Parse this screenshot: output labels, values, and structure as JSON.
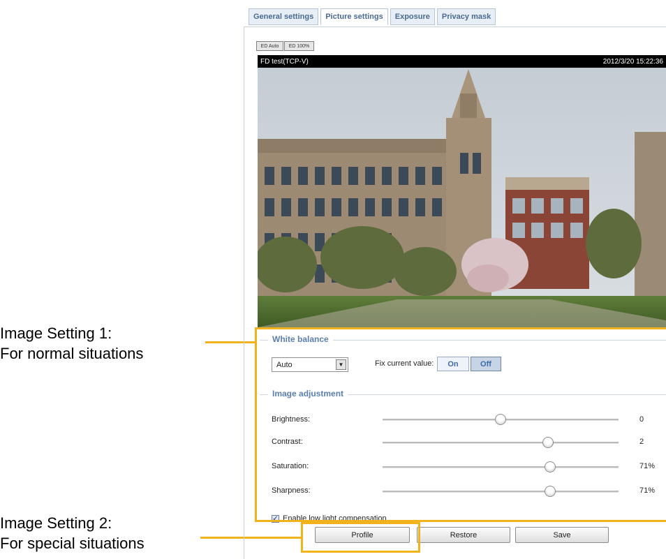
{
  "callouts": {
    "setting1": {
      "line1": "Image Setting 1:",
      "line2": "For normal situations"
    },
    "setting2": {
      "line1": "Image Setting 2:",
      "line2": "For special situations"
    },
    "color": "#f2b21c"
  },
  "tabs": [
    {
      "label": "General settings"
    },
    {
      "label": "Picture settings"
    },
    {
      "label": "Exposure"
    },
    {
      "label": "Privacy mask"
    }
  ],
  "view_buttons": [
    {
      "label": "ED Auto"
    },
    {
      "label": "ED 100%"
    }
  ],
  "video": {
    "stream_name": "FD test(TCP-V)",
    "timestamp": "2012/3/20 15:22:36"
  },
  "white_balance": {
    "legend": "White balance",
    "mode": "Auto",
    "fix_label": "Fix current value:",
    "on_label": "On",
    "off_label": "Off",
    "selected": "Off"
  },
  "image_adjustment": {
    "legend": "Image adjustment",
    "sliders": [
      {
        "label": "Brightness:",
        "value": "0",
        "level": 0.5
      },
      {
        "label": "Contrast:",
        "value": "2",
        "level": 0.7
      },
      {
        "label": "Saturation:",
        "value": "71%",
        "level": 0.71
      },
      {
        "label": "Sharpness:",
        "value": "71%",
        "level": 0.71
      }
    ],
    "low_light_label": "Enable low light compensation",
    "low_light_checked": true
  },
  "actions": {
    "profile": "Profile",
    "restore": "Restore",
    "save": "Save"
  },
  "colors": {
    "accent": "#5b7fb0",
    "tab_text": "#4b6a94"
  }
}
